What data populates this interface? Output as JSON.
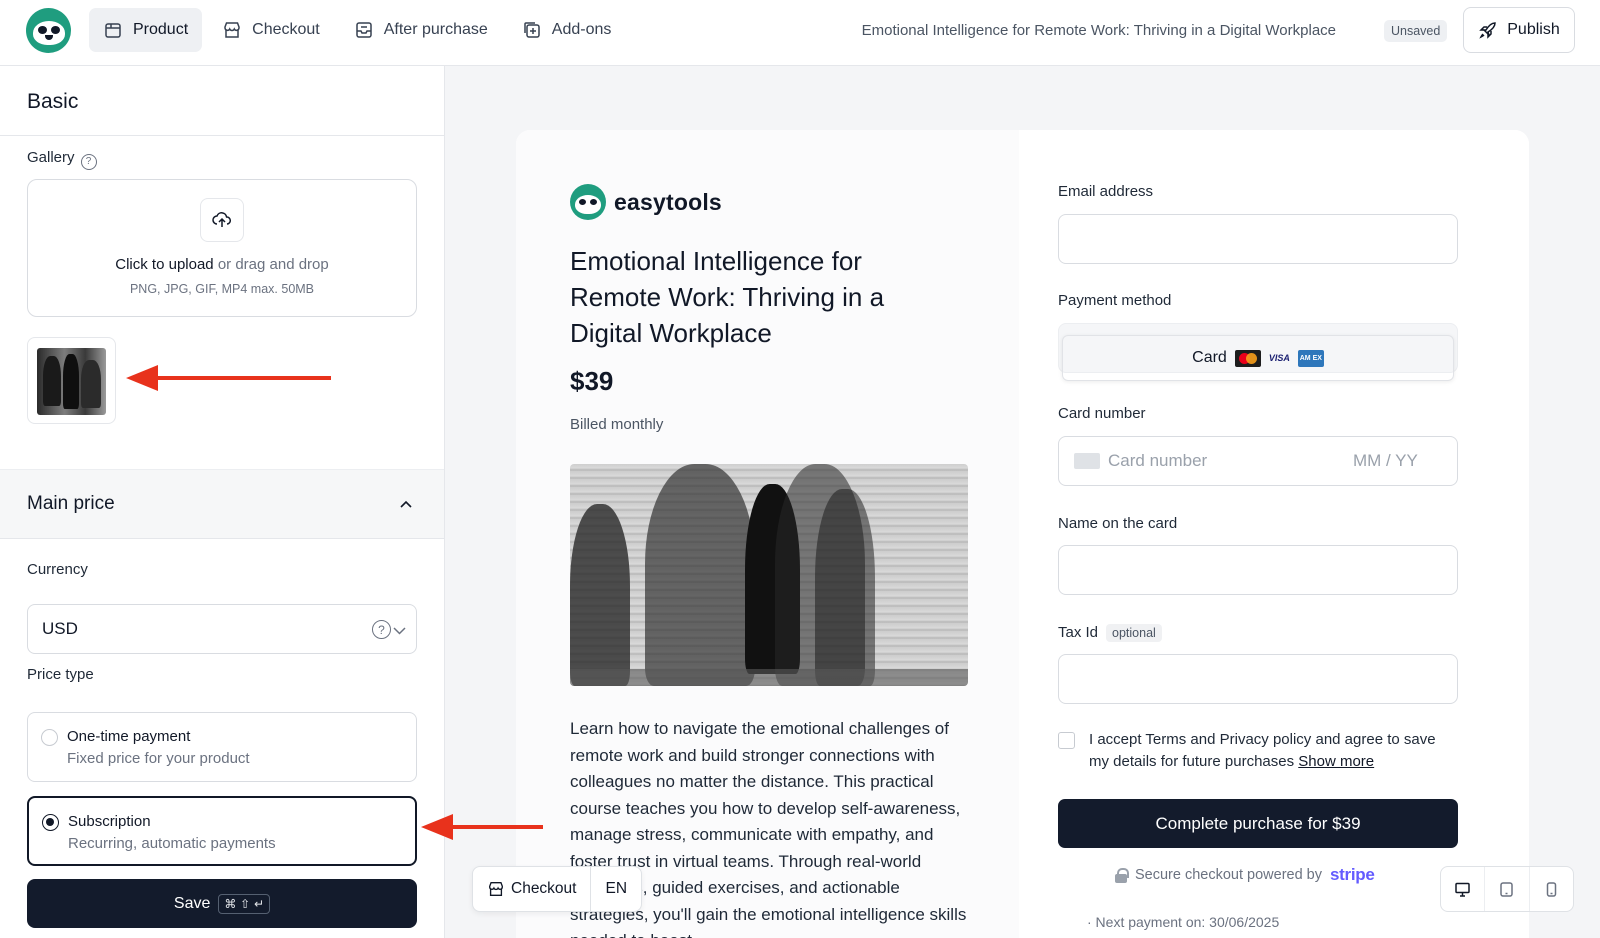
{
  "topbar": {
    "nav": [
      {
        "label": "Product",
        "icon": "box-icon",
        "active": true
      },
      {
        "label": "Checkout",
        "icon": "store-icon",
        "active": false
      },
      {
        "label": "After purchase",
        "icon": "inbox-icon",
        "active": false
      },
      {
        "label": "Add-ons",
        "icon": "plus-square-icon",
        "active": false
      }
    ],
    "document_title": "Emotional Intelligence for Remote Work: Thriving in a Digital Workplace",
    "status_badge": "Unsaved",
    "publish_label": "Publish"
  },
  "sidebar": {
    "section_title": "Basic",
    "gallery": {
      "label": "Gallery",
      "upload_link": "Click to upload",
      "upload_rest": " or drag and drop",
      "upload_hint": "PNG, JPG, GIF, MP4 max. 50MB"
    },
    "main_price": {
      "title": "Main price",
      "currency_label": "Currency",
      "currency_value": "USD",
      "price_type_label": "Price type",
      "options": [
        {
          "title": "One-time payment",
          "subtitle": "Fixed price for your product",
          "selected": false
        },
        {
          "title": "Subscription",
          "subtitle": "Recurring, automatic payments",
          "selected": true
        }
      ]
    },
    "save_label": "Save",
    "save_shortcut": "⌘ ⇧ ↵"
  },
  "preview": {
    "brand_name": "easytools",
    "product_title": "Emotional Intelligence for Remote Work: Thriving in a Digital Workplace",
    "price": "$39",
    "billing": "Billed monthly",
    "description": "Learn how to navigate the emotional challenges of remote work and build stronger connections with colleagues no matter the distance. This practical course teaches you how to develop self-awareness, manage stress, communicate with empathy, and foster trust in virtual teams. Through real-world scenarios, guided exercises, and actionable strategies, you'll gain the emotional intelligence skills needed to boost",
    "form": {
      "email_label": "Email address",
      "payment_label": "Payment method",
      "payment_option": "Card",
      "visa_text": "VISA",
      "amex_text": "AM EX",
      "card_number_label": "Card number",
      "card_number_placeholder": "Card number",
      "expiry_placeholder": "MM / YY",
      "name_label": "Name on the card",
      "tax_label": "Tax Id",
      "tax_optional": "optional",
      "terms_text": "I accept Terms and Privacy policy and agree to save my details for future purchases ",
      "show_more": "Show more",
      "purchase_label": "Complete purchase for $39",
      "secure_text": "Secure checkout powered by",
      "stripe_text": "stripe",
      "bottom_peek": "· Next payment on: 30/06/2025"
    }
  },
  "floating_bar": {
    "checkout_label": "Checkout",
    "language": "EN"
  },
  "device_toggles": [
    "desktop-icon",
    "tablet-icon",
    "mobile-icon"
  ],
  "colors": {
    "accent_dark": "#131b2c",
    "brand_green": "#1f9d7f",
    "annotation_red": "#e8321c",
    "stripe_purple": "#635bff"
  }
}
